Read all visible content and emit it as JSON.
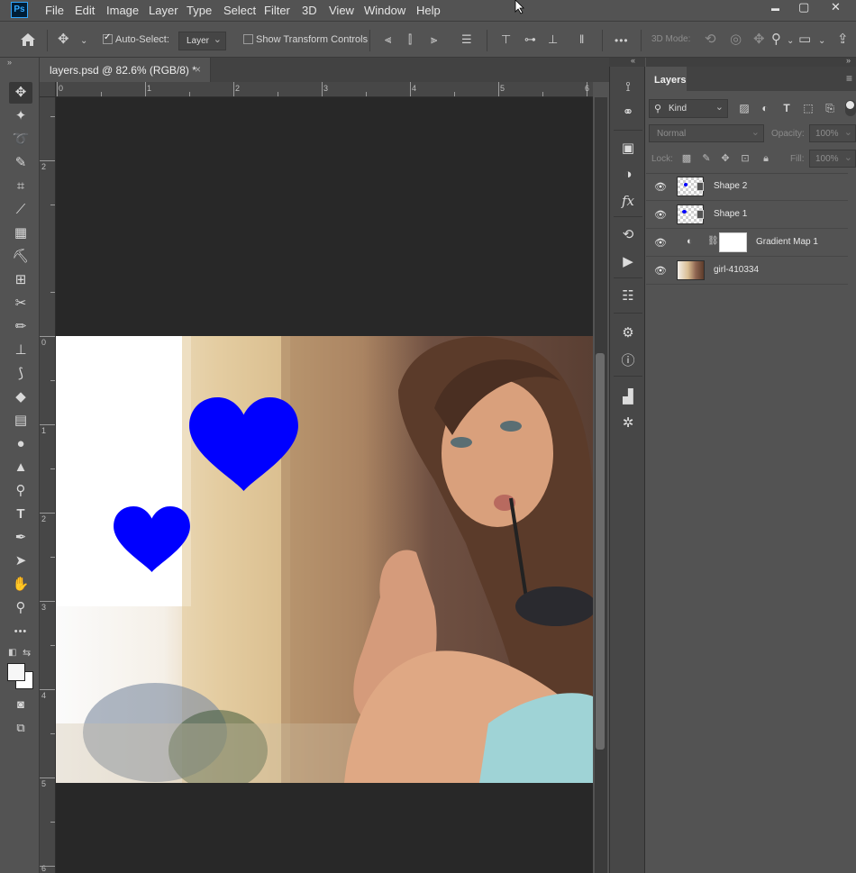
{
  "app": {
    "logo": "Ps"
  },
  "menu": [
    "File",
    "Edit",
    "Image",
    "Layer",
    "Type",
    "Select",
    "Filter",
    "3D",
    "View",
    "Window",
    "Help"
  ],
  "window_controls": {
    "minimize": "▬",
    "restore": "▢",
    "close": "✕"
  },
  "options_bar": {
    "auto_select_label": "Auto-Select:",
    "auto_select_checked": true,
    "auto_select_target": "Layer",
    "show_transform_label": "Show Transform Controls",
    "show_transform_checked": false,
    "more_label": "•••",
    "mode_3d_label": "3D Mode:"
  },
  "document_tab": {
    "title": "layers.psd @ 82.6% (RGB/8) *",
    "close": "×"
  },
  "rulers": {
    "top": [
      "0",
      "1",
      "2",
      "3",
      "4",
      "5",
      "6"
    ],
    "left": [
      "2",
      "0",
      "1",
      "2",
      "3",
      "4",
      "5",
      "6"
    ]
  },
  "canvas": {
    "shape_color": "#0000ff",
    "workspace_color": "#282828"
  },
  "layers_panel": {
    "tab_label": "Layers",
    "menu_icon": "≡",
    "filter_kind": "Kind",
    "blend_mode": "Normal",
    "opacity_label": "Opacity:",
    "opacity_value": "100%",
    "lock_label": "Lock:",
    "fill_label": "Fill:",
    "fill_value": "100%",
    "layers": [
      {
        "name": "Shape 2",
        "type": "shape",
        "visible": true
      },
      {
        "name": "Shape 1",
        "type": "shape",
        "visible": true
      },
      {
        "name": "Gradient Map 1",
        "type": "adjustment",
        "visible": true
      },
      {
        "name": "girl-410334",
        "type": "image",
        "visible": true
      }
    ]
  }
}
